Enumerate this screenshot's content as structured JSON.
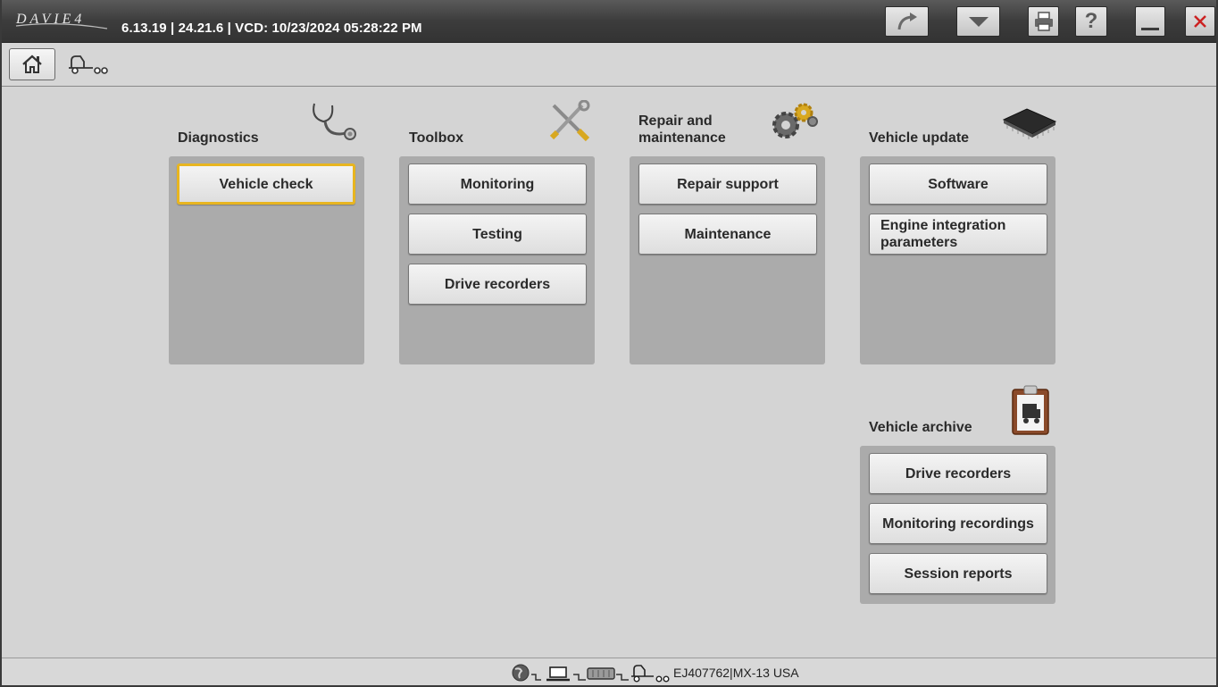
{
  "app": {
    "logo_text": "DAVIE4",
    "title": "6.13.19 | 24.21.6 | VCD: 10/23/2024 05:28:22 PM"
  },
  "toolbar": {
    "icons": [
      "redo-arrow-icon",
      "dropdown-arrow-icon",
      "printer-icon",
      "help-icon",
      "minimize-icon",
      "close-icon"
    ],
    "close_color": "#cc2222"
  },
  "nav": {
    "icons": [
      "home-icon",
      "vehicle-icon"
    ]
  },
  "sections": {
    "diagnostics": {
      "title": "Diagnostics",
      "icon": "stethoscope-icon",
      "buttons": [
        "Vehicle check"
      ]
    },
    "toolbox": {
      "title": "Toolbox",
      "icon": "tools-icon",
      "buttons": [
        "Monitoring",
        "Testing",
        "Drive recorders"
      ]
    },
    "repair": {
      "title": "Repair and maintenance",
      "icon": "gears-icon",
      "buttons": [
        "Repair support",
        "Maintenance"
      ]
    },
    "update": {
      "title": "Vehicle update",
      "icon": "chip-icon",
      "buttons": [
        "Software",
        "Engine integration parameters"
      ]
    },
    "archive": {
      "title": "Vehicle archive",
      "icon": "clipboard-icon",
      "buttons": [
        "Drive recorders",
        "Monitoring recordings",
        "Session reports"
      ]
    }
  },
  "status": {
    "icons": [
      "globe-icon",
      "laptop-icon",
      "interface-icon",
      "vehicle-icon"
    ],
    "connection_text": "EJ407762|MX-13 USA"
  },
  "colors": {
    "selected_border": "#e8b520",
    "panel": "#ababab",
    "background": "#d4d4d4"
  }
}
